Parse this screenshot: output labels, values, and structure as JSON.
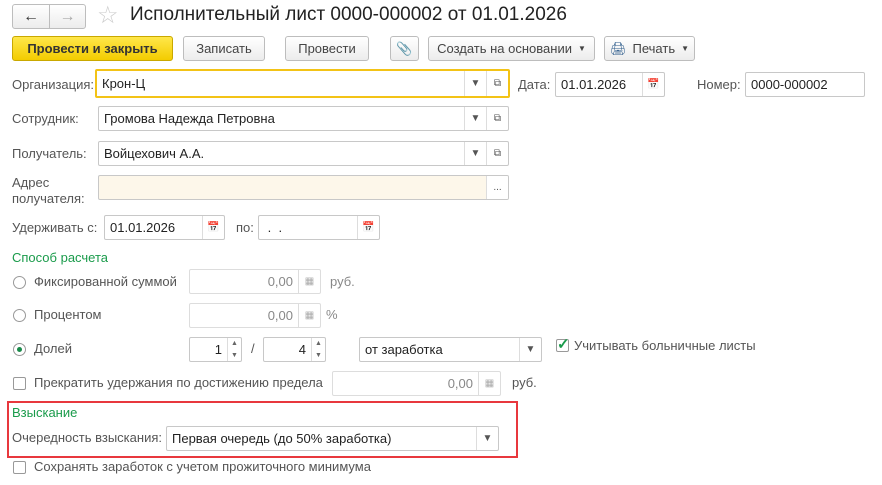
{
  "header": {
    "title": "Исполнительный лист 0000-000002 от 01.01.2026"
  },
  "toolbar": {
    "post_close": "Провести и закрыть",
    "save": "Записать",
    "post": "Провести",
    "create_based": "Создать на основании",
    "print": "Печать"
  },
  "form": {
    "org_label": "Организация:",
    "org_value": "Крон-Ц",
    "date_label": "Дата:",
    "date_value": "01.01.2026",
    "number_label": "Номер:",
    "number_value": "0000-000002",
    "employee_label": "Сотрудник:",
    "employee_value": "Громова Надежда Петровна",
    "recipient_label": "Получатель:",
    "recipient_value": "Войцехович А.А.",
    "address_label_1": "Адрес",
    "address_label_2": "получателя:",
    "address_value": "",
    "withhold_from_label": "Удерживать с:",
    "withhold_from_value": "01.01.2026",
    "withhold_to_label": "по:",
    "withhold_to_value": " .  .",
    "calc_section": "Способ расчета",
    "fixed_label": "Фиксированной суммой",
    "fixed_value": "0,00",
    "fixed_unit": "руб.",
    "percent_label": "Процентом",
    "percent_value": "0,00",
    "percent_unit": "%",
    "share_label": "Долей",
    "share_num": "1",
    "share_sep": "/",
    "share_den": "4",
    "share_base": "от заработка",
    "sick_label": "Учитывать больничные листы",
    "sick_checked": true,
    "selected_method": "Долей",
    "stop_label": "Прекратить удержания по достижению предела",
    "stop_value": "0,00",
    "stop_unit": "руб.",
    "stop_checked": false,
    "collection_section": "Взыскание",
    "priority_label": "Очередность взыскания:",
    "priority_value": "Первая очередь (до 50% заработка)",
    "keep_min_label": "Сохранять заработок с учетом прожиточного минимума",
    "keep_min_checked": false
  },
  "colors": {
    "accent_yellow": "#f3cc00",
    "section_green": "#1a9b4b",
    "highlight_red": "#e8383d"
  }
}
